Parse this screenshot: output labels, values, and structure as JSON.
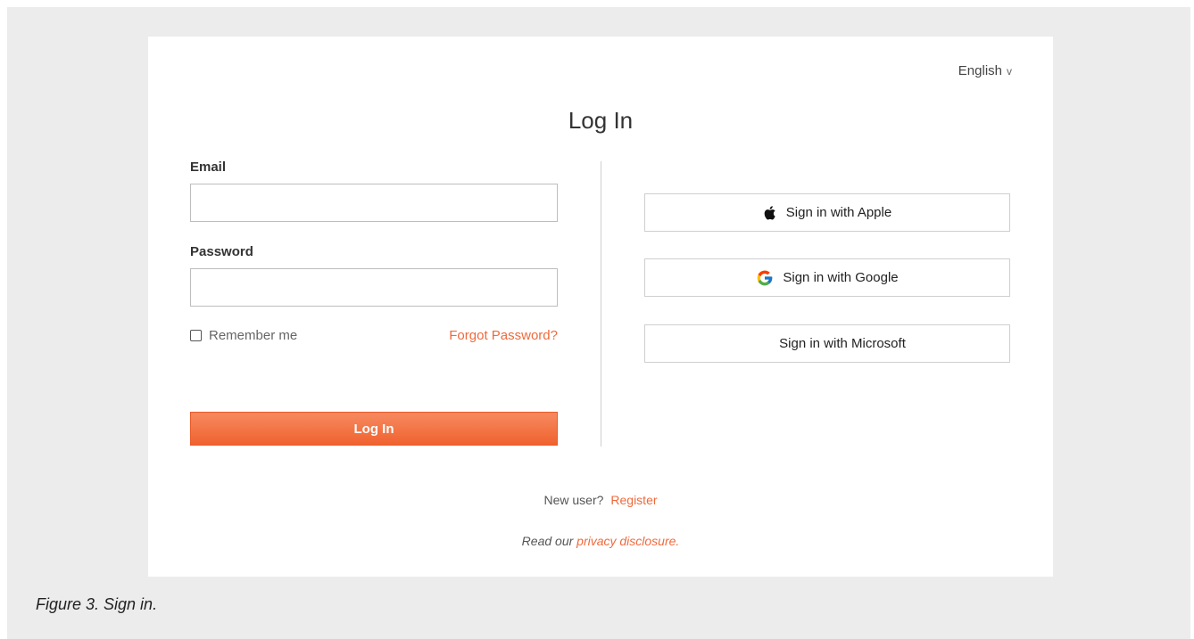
{
  "language": {
    "label": "English",
    "chevron": "v"
  },
  "form": {
    "title": "Log In",
    "email_label": "Email",
    "email_value": "",
    "password_label": "Password",
    "password_value": "",
    "remember_label": "Remember me",
    "remember_checked": false,
    "forgot_label": "Forgot Password?",
    "submit_label": "Log In"
  },
  "sso": {
    "apple_label": "Sign in with Apple",
    "google_label": "Sign in with Google",
    "microsoft_label": "Sign in with Microsoft"
  },
  "footer": {
    "new_user_text": "New user?",
    "register_label": "Register",
    "privacy_prefix": "Read our",
    "privacy_link": "privacy disclosure."
  },
  "caption": "Figure 3. Sign in.",
  "colors": {
    "accent": "#ee6a3c",
    "button_top": "#f68a60",
    "button_bottom": "#f0622f",
    "frame_bg": "#ececec"
  },
  "icons": [
    "apple-icon",
    "google-icon",
    "microsoft-icon",
    "chevron-down-icon",
    "checkbox"
  ]
}
